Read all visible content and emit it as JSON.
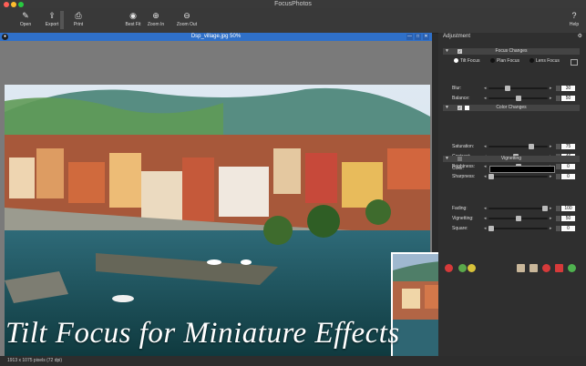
{
  "window": {
    "title": "FocusPhotos"
  },
  "toolbar": {
    "open": "Open",
    "export": "Export",
    "print": "Print",
    "best_fit": "Best Fit",
    "zoom_in": "Zoom In",
    "zoom_out": "Zoom Out",
    "help": "Help"
  },
  "document": {
    "title": "Dsp_village.jpg 50%"
  },
  "caption": "Tilt Focus for Miniature Effects",
  "status": "1913 x 1075 pixels (72 dpi)",
  "panel": {
    "title": "Adjustment",
    "focus": {
      "header": "Focus Changes",
      "modes": [
        "Tilt Focus",
        "Plan Focus",
        "Lens Focus"
      ],
      "rows": [
        {
          "label": "Blur:",
          "value": "30",
          "level": 0.3
        },
        {
          "label": "Balance:",
          "value": "50",
          "level": 0.5
        },
        {
          "label": "Grain:",
          "value": "0",
          "level": 0.0
        }
      ]
    },
    "color": {
      "header": "Color Changes",
      "rows": [
        {
          "label": "Saturation:",
          "value": "75",
          "level": 0.75
        },
        {
          "label": "Contrast:",
          "value": "46",
          "level": 0.46
        },
        {
          "label": "Brightness:",
          "value": "0",
          "level": 0.5
        },
        {
          "label": "Sharpness:",
          "value": "0",
          "level": 0.0
        }
      ]
    },
    "vignetting": {
      "header": "Vignetting",
      "color_label": "Color:",
      "rows": [
        {
          "label": "Fading:",
          "value": "100",
          "level": 1.0
        },
        {
          "label": "Vignetting:",
          "value": "50",
          "level": 0.5
        },
        {
          "label": "Square:",
          "value": "0",
          "level": 0.0
        }
      ]
    }
  },
  "colors": {
    "accent": "#2f70c9",
    "panel": "#2f2f2f",
    "toolbar": "#393939"
  }
}
